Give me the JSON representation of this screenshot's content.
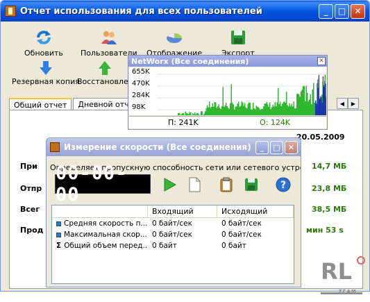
{
  "main_window": {
    "title": "Отчет использования для всех пользователей",
    "controls": {
      "minimize": "_",
      "maximize": "□",
      "close": "✕"
    }
  },
  "toolbar": {
    "refresh": "Обновить",
    "users": "Пользователи",
    "display": "Отображение",
    "export": "Экспорт",
    "backup": "Резервная копия",
    "restore": "Восстановлен"
  },
  "tabs": {
    "general": "Общий отчет",
    "daily": "Дневной отчет"
  },
  "report": {
    "date": "20.05.2009",
    "rows": [
      {
        "label": "При",
        "value": "14,7 МБ"
      },
      {
        "label": "Отпр",
        "value": "23,8 МБ"
      },
      {
        "label": "Всег",
        "value": "38,5 МБ"
      },
      {
        "label": "Прод",
        "value": "мин 53 s"
      }
    ]
  },
  "graph_window": {
    "title": "NetWorx (Все соединения)",
    "y_labels": [
      "655K",
      "470K",
      "284K",
      "98K"
    ],
    "download": "П: 241K",
    "upload": "О: 124K"
  },
  "speed_window": {
    "title": "Измерение скорости (Все соединения)",
    "description": "Определяет пропускную способность сети или сетевого устройства",
    "timer": "00-00-00",
    "columns": [
      "",
      "Входящий",
      "Исходящий"
    ],
    "rows": [
      {
        "icon": "square",
        "name": "Средняя скорость п...",
        "incoming": "0 байт/сек",
        "outgoing": "0 байт/сек"
      },
      {
        "icon": "square",
        "name": "Максимальная скор...",
        "incoming": "0 байт/сек",
        "outgoing": "0 байт/сек"
      },
      {
        "icon": "sigma",
        "name": "Общий объем перед...",
        "incoming": "0 байт",
        "outgoing": "0 байт"
      }
    ]
  },
  "watermark": {
    "text": "RL",
    "sub": "TEAM"
  }
}
